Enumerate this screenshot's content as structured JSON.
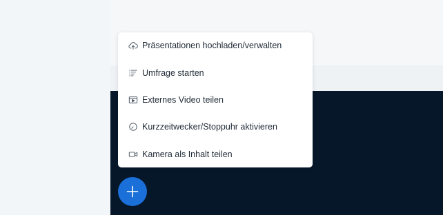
{
  "menu": {
    "items": [
      {
        "label": "Präsentationen hochladen/verwalten",
        "icon": "upload-cloud-icon"
      },
      {
        "label": "Umfrage starten",
        "icon": "poll-list-icon"
      },
      {
        "label": "Externes Video teilen",
        "icon": "external-video-icon"
      },
      {
        "label": "Kurzzeitwecker/Stoppuhr aktivieren",
        "icon": "timer-icon"
      },
      {
        "label": "Kamera als Inhalt teilen",
        "icon": "camera-icon"
      }
    ]
  },
  "fab": {
    "icon": "plus-icon"
  },
  "colors": {
    "fab_background": "#1b6fd9",
    "media_background": "#06172a",
    "page_background": "#f3f6f9"
  }
}
